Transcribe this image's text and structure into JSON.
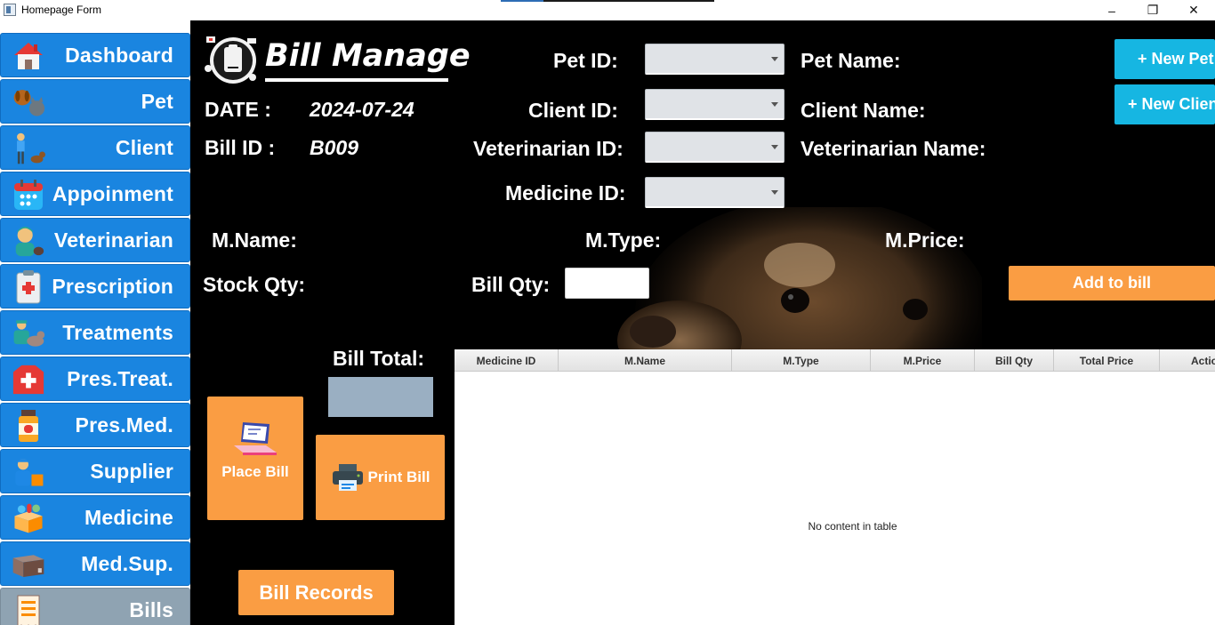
{
  "window": {
    "title": "Homepage Form",
    "controls": {
      "minimize": "–",
      "maximize": "❐",
      "close": "✕"
    }
  },
  "sidebar": {
    "items": [
      {
        "label": "Dashboard",
        "icon": "house-icon",
        "active": false
      },
      {
        "label": "Pet",
        "icon": "pets-icon",
        "active": false
      },
      {
        "label": "Client",
        "icon": "person-with-dog-icon",
        "active": false
      },
      {
        "label": "Appoinment",
        "icon": "calendar-icon",
        "active": false
      },
      {
        "label": "Veterinarian",
        "icon": "veterinarian-icon",
        "active": false
      },
      {
        "label": "Prescription",
        "icon": "clipboard-icon",
        "active": false
      },
      {
        "label": "Treatments",
        "icon": "treatment-icon",
        "active": false
      },
      {
        "label": "Pres.Treat.",
        "icon": "first-aid-icon",
        "active": false
      },
      {
        "label": "Pres.Med.",
        "icon": "pill-bottle-icon",
        "active": false
      },
      {
        "label": "Supplier",
        "icon": "delivery-man-icon",
        "active": false
      },
      {
        "label": "Medicine",
        "icon": "medicine-box-icon",
        "active": false
      },
      {
        "label": "Med.Sup.",
        "icon": "cardboard-box-icon",
        "active": false
      },
      {
        "label": "Bills",
        "icon": "receipt-icon",
        "active": true
      }
    ]
  },
  "header": {
    "title": "Bill Manage",
    "date_label": "DATE :",
    "date_value": "2024-07-24",
    "bill_id_label": "Bill ID :",
    "bill_id_value": "B009"
  },
  "form": {
    "pet_id_label": "Pet ID:",
    "client_id_label": "Client ID:",
    "vet_id_label": "Veterinarian ID:",
    "medicine_id_label": "Medicine ID:",
    "pet_name_label": "Pet Name:",
    "client_name_label": "Client Name:",
    "vet_name_label": "Veterinarian Name:",
    "m_name_label": "M.Name:",
    "m_type_label": "M.Type:",
    "m_price_label": "M.Price:",
    "stock_qty_label": "Stock Qty:",
    "bill_qty_label": "Bill Qty:",
    "bill_qty_value": "",
    "bill_total_label": "Bill Total:",
    "bill_total_value": ""
  },
  "buttons": {
    "new_pet": "+ New Pet",
    "new_client": "+ New Client",
    "add_to_bill": "Add to bill",
    "place_bill": "Place Bill",
    "print_bill": "Print Bill",
    "bill_records": "Bill Records"
  },
  "table": {
    "columns": [
      "Medicine ID",
      "M.Name",
      "M.Type",
      "M.Price",
      "Bill Qty",
      "Total Price",
      "Action"
    ],
    "rows": [],
    "empty_message": "No content in table"
  },
  "colors": {
    "sidebar_blue": "#1a85e0",
    "sidebar_active": "#8fa3b2",
    "accent_orange": "#fa9d43",
    "accent_cyan": "#16b6e2",
    "background": "#000000"
  }
}
